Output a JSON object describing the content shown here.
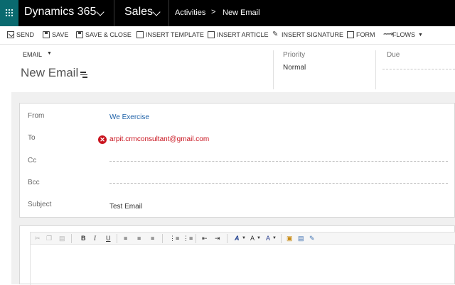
{
  "topnav": {
    "brand": "Dynamics 365",
    "app": "Sales",
    "breadcrumb": [
      "Activities",
      "New Email"
    ],
    "breadcrumb_separator": ">"
  },
  "commands": [
    {
      "label": "SEND",
      "icon": "envelope-icon"
    },
    {
      "label": "SAVE",
      "icon": "save-icon"
    },
    {
      "label": "SAVE & CLOSE",
      "icon": "save-close-icon"
    },
    {
      "label": "INSERT TEMPLATE",
      "icon": "insert-template-icon"
    },
    {
      "label": "INSERT ARTICLE",
      "icon": "insert-article-icon"
    },
    {
      "label": "INSERT SIGNATURE",
      "icon": "insert-signature-icon"
    },
    {
      "label": "FORM",
      "icon": "form-icon"
    },
    {
      "label": "FLOWS",
      "icon": "flows-icon"
    }
  ],
  "header": {
    "entity": "EMAIL",
    "title": "New Email",
    "priority_label": "Priority",
    "priority_value": "Normal",
    "due_label": "Due"
  },
  "form": {
    "from_label": "From",
    "from_value": "We Exercise",
    "to_label": "To",
    "to_value": "arpit.crmconsultant@gmail.com",
    "cc_label": "Cc",
    "bcc_label": "Bcc",
    "subject_label": "Subject",
    "subject_value": "Test Email"
  },
  "editor_toolbar": {
    "bold": "B",
    "italic": "I",
    "underline": "U",
    "font_color": "A",
    "font_size": "A",
    "highlight": "A"
  },
  "colors": {
    "nav_bg": "#000000",
    "grid_tile": "#0a6a6f",
    "link": "#1f62a8",
    "error": "#c9131e"
  }
}
